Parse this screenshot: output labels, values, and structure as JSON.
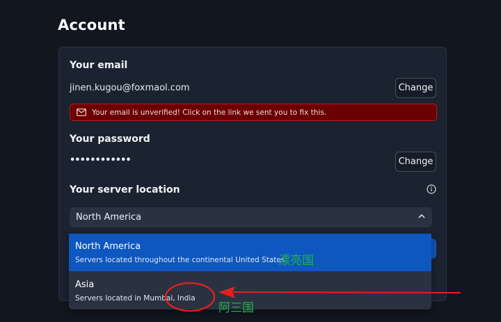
{
  "page": {
    "title": "Account"
  },
  "email": {
    "label": "Your email",
    "value": "jinen.kugou@foxmaol.com",
    "change_label": "Change",
    "alert": "Your email is unverified! Click on the link we sent you to fix this."
  },
  "password": {
    "label": "Your password",
    "value": "••••••••••••",
    "change_label": "Change"
  },
  "server": {
    "label": "Your server location",
    "selected": "North America",
    "options": [
      {
        "title": "North America",
        "desc": "Servers located throughout the continental United States"
      },
      {
        "title": "Asia",
        "desc": "Servers located in Mumbai, India"
      }
    ]
  },
  "annotations": {
    "note_na": "漂亮国",
    "note_asia": "阿三国"
  },
  "colors": {
    "background": "#11161f",
    "card": "#1b2230",
    "alert_bg": "#6b0000",
    "selected_option": "#0e57c0",
    "annotation_red": "#e8201c",
    "annotation_green": "#23b14d"
  },
  "icons": [
    "mail-icon",
    "info-icon",
    "chevron-up-icon"
  ]
}
